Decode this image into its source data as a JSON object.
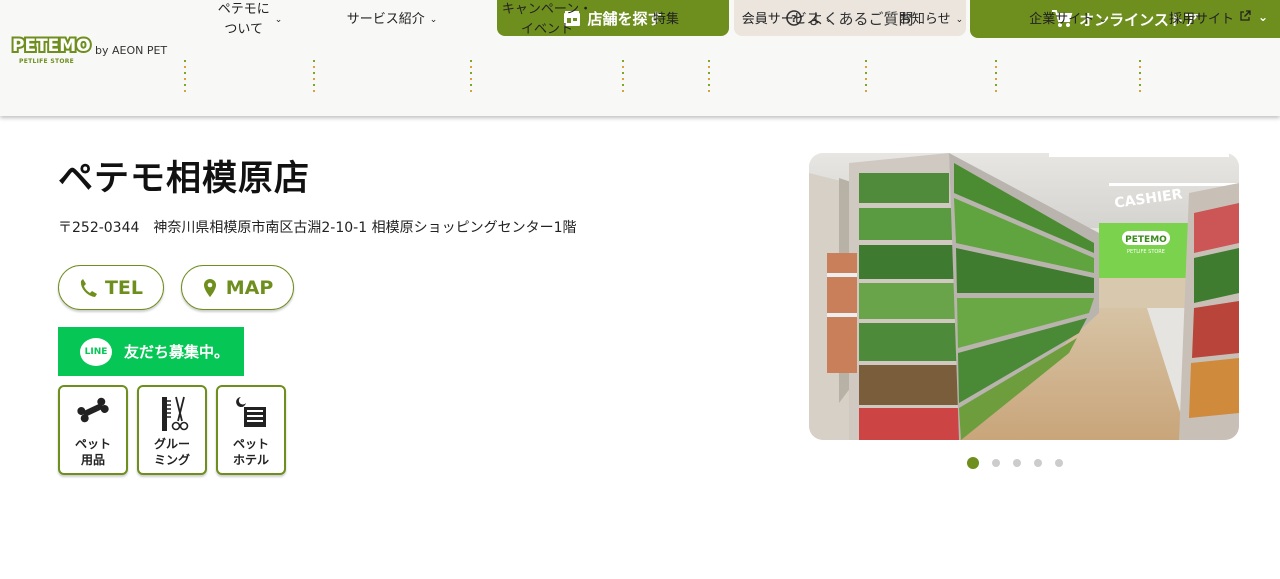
{
  "brand": {
    "logo_text": "PETEMO",
    "logo_sub": "PETLIFE STORE",
    "by_text": "by AEON PET",
    "accent": "#6e8e1e",
    "line_green": "#06c755"
  },
  "top_buttons": {
    "store_search": {
      "label": "店舗を探す",
      "icon": "store-icon"
    },
    "faq": {
      "label": "よくあるご質問",
      "icon": "question-circle-icon"
    },
    "online_store": {
      "label": "オンラインストア",
      "icon": "cart-icon"
    }
  },
  "nav": [
    {
      "label": "ペテモに\nついて",
      "dropdown": true
    },
    {
      "label": "サービス紹介",
      "dropdown": true
    },
    {
      "label": "キャンペーン・\nイベント",
      "dropdown": false
    },
    {
      "label": "特集",
      "dropdown": false
    },
    {
      "label": "会員サービス",
      "dropdown": true
    },
    {
      "label": "お知らせ",
      "dropdown": true
    },
    {
      "label": "企業サイト",
      "dropdown": true
    },
    {
      "label": "採用サイト",
      "external": true
    }
  ],
  "store": {
    "name": "ペテモ相模原店",
    "address": "〒252-0344　神奈川県相模原市南区古淵2-10-1 相模原ショッピングセンター1階",
    "tel_label": "TEL",
    "map_label": "MAP",
    "line_label": "友だち募集中。",
    "line_logo_text": "LINE"
  },
  "services": [
    {
      "label1": "ペット",
      "label2": "用品",
      "icon": "bone-icon"
    },
    {
      "label1": "グルー",
      "label2": "ミング",
      "icon": "comb-scissors-icon"
    },
    {
      "label1": "ペット",
      "label2": "ホテル",
      "icon": "hotel-icon"
    }
  ],
  "photo": {
    "sign_text": "CASHIER",
    "store_sign_text": "PETEMO",
    "store_sign_sub": "PETLIFE STORE"
  },
  "carousel": {
    "count": 5,
    "active_index": 0
  }
}
